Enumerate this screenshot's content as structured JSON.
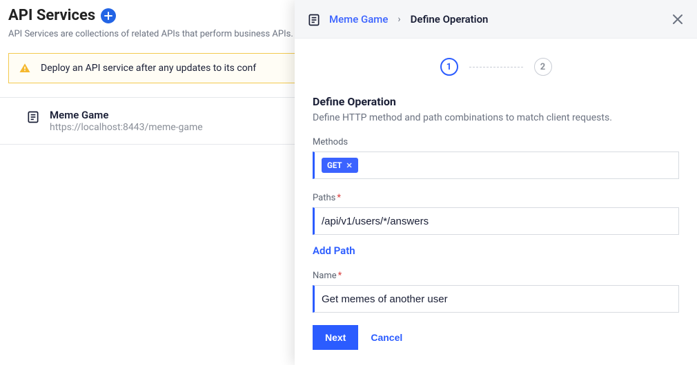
{
  "header": {
    "title": "API Services",
    "description": "API Services are collections of related APIs that perform business APIs."
  },
  "alert": {
    "message": "Deploy an API service after any updates to its conf"
  },
  "services": [
    {
      "name": "Meme Game",
      "url": "https://localhost:8443/meme-game"
    }
  ],
  "panel": {
    "breadcrumb": {
      "link": "Meme Game",
      "current": "Define Operation"
    },
    "stepper": {
      "active": "1",
      "inactive": "2"
    },
    "title": "Define Operation",
    "subtitle": "Define HTTP method and path combinations to match client requests.",
    "labels": {
      "methods": "Methods",
      "paths": "Paths",
      "name": "Name"
    },
    "methods": [
      "GET"
    ],
    "paths_value": "/api/v1/users/*/answers",
    "add_path": "Add Path",
    "name_value": "Get memes of another user",
    "footer": {
      "next": "Next",
      "cancel": "Cancel"
    }
  }
}
